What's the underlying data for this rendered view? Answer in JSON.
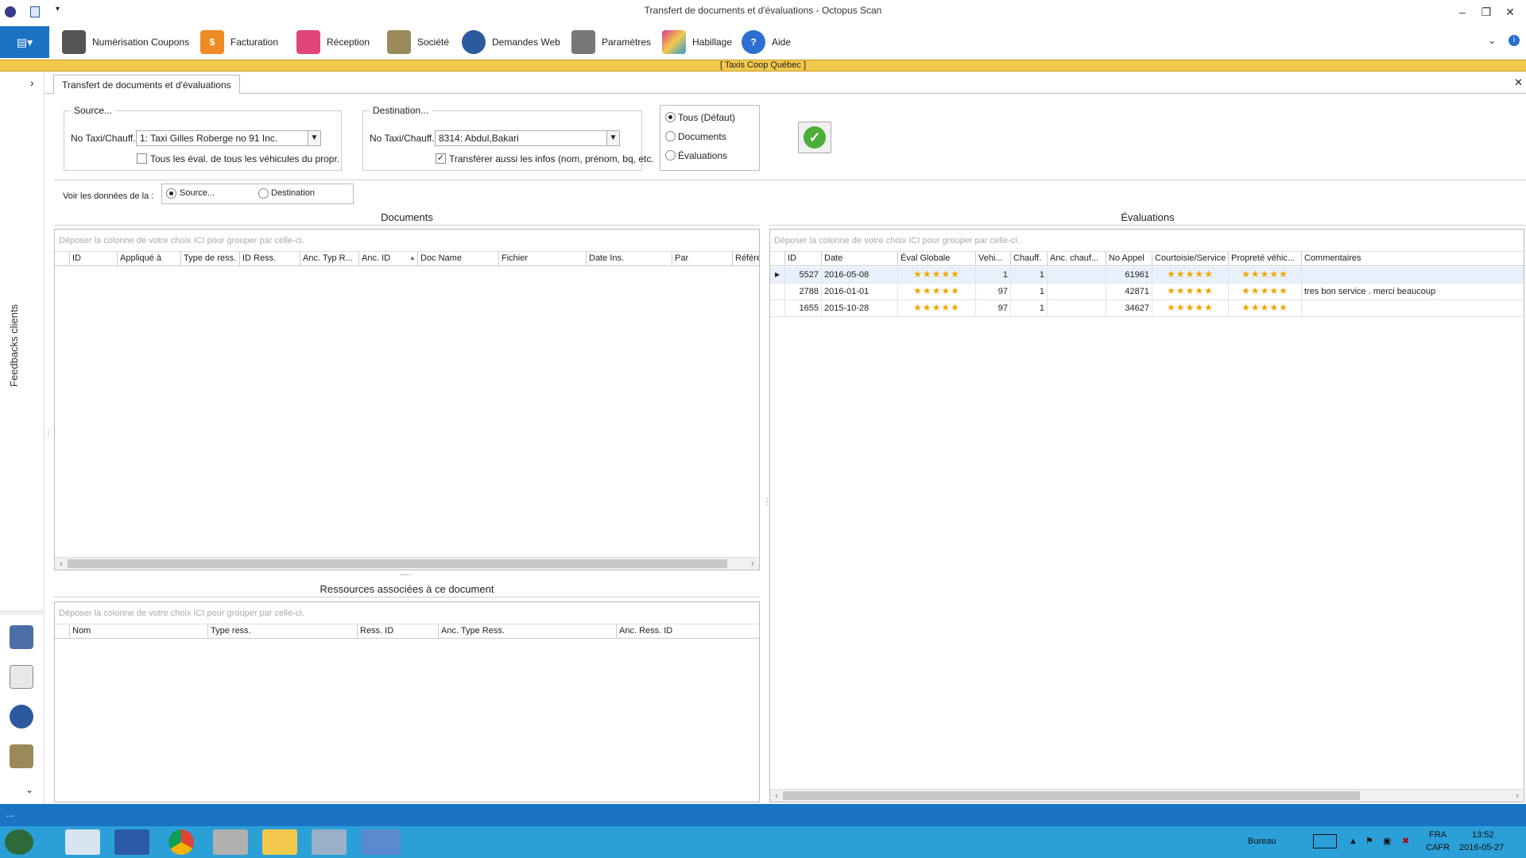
{
  "window": {
    "title": "Transfert de documents et d'évaluations - Octopus Scan"
  },
  "menu": [
    {
      "label": "Numérisation Coupons",
      "icon": "scanner-icon",
      "color": "#555555"
    },
    {
      "label": "Facturation",
      "icon": "billing-icon",
      "color": "#f08a24"
    },
    {
      "label": "Réception",
      "icon": "home-icon",
      "color": "#e0457b"
    },
    {
      "label": "Société",
      "icon": "building-icon",
      "color": "#9a8a5a"
    },
    {
      "label": "Demandes Web",
      "icon": "globe-icon",
      "color": "#2c5aa0"
    },
    {
      "label": "Paramètres",
      "icon": "tools-icon",
      "color": "#777777"
    },
    {
      "label": "Habillage",
      "icon": "palette-icon",
      "color": "#d63c8a"
    },
    {
      "label": "Aide",
      "icon": "help-icon",
      "color": "#2a6fd1"
    }
  ],
  "company": "[   Taxis Coop Québec   ]",
  "sidebar": {
    "label": "Feedbacks clients"
  },
  "tab": {
    "label": "Transfert de documents et d'évaluations"
  },
  "source": {
    "legend": "Source...",
    "field_label": "No Taxi/Chauff.",
    "value": "1: Taxi Gilles Roberge no 91 Inc.",
    "checkbox_label": "Tous les éval. de tous les véhicules du propr.",
    "checkbox_checked": false
  },
  "destination": {
    "legend": "Destination...",
    "field_label": "No Taxi/Chauff.",
    "value": "8314: Abdul,Bakari",
    "checkbox_label": "Transférer aussi les infos (nom, prénom, bq, etc.",
    "checkbox_checked": true
  },
  "filter": {
    "options": [
      "Tous (Défaut)",
      "Documents",
      "Évaluations"
    ],
    "selected": "Tous (Défaut)"
  },
  "view": {
    "label": "Voir les données de la :",
    "options": [
      "Source...",
      "Destination"
    ],
    "selected": "Source..."
  },
  "group_hint": "Déposer la colonne de votre choix ICI pour grouper par celle-ci.",
  "documents": {
    "title": "Documents",
    "columns": [
      "ID",
      "Appliqué à",
      "Type de ress.",
      "ID Ress.",
      "Anc. Typ R...",
      "Anc. ID",
      "Doc Name",
      "Fichier",
      "Date Ins.",
      "Par",
      "Référe"
    ]
  },
  "resources": {
    "title": "Ressources associées à ce document",
    "columns": [
      "Nom",
      "Type ress.",
      "Ress. ID",
      "Anc. Type Ress.",
      "Anc. Ress. ID"
    ]
  },
  "evaluations": {
    "title": "Évaluations",
    "columns": [
      "ID",
      "Date",
      "Éval Globale",
      "Vehi...",
      "Chauff.",
      "Anc. chauf...",
      "No Appel",
      "Courtoisie/Service",
      "Propreté véhic...",
      "Commentaires"
    ],
    "rows": [
      {
        "id": "5527",
        "date": "2016-05-08",
        "global": 5,
        "vehicle": "1",
        "driver": "1",
        "old_driver": "",
        "call": "61961",
        "courtesy": 5,
        "cleanliness": 5,
        "comment": ""
      },
      {
        "id": "2788",
        "date": "2016-01-01",
        "global": 5,
        "vehicle": "97",
        "driver": "1",
        "old_driver": "",
        "call": "42871",
        "courtesy": 5,
        "cleanliness": 5,
        "comment": "tres bon service . merci beaucoup"
      },
      {
        "id": "1655",
        "date": "2015-10-28",
        "global": 5,
        "vehicle": "97",
        "driver": "1",
        "old_driver": "",
        "call": "34627",
        "courtesy": 5,
        "cleanliness": 5,
        "comment": ""
      }
    ]
  },
  "statusbar": {
    "text": "..."
  },
  "taskbar": {
    "desktop_label": "Bureau",
    "lang1": "FRA",
    "lang2": "CAFR",
    "time": "13:52",
    "date": "2016-05-27"
  }
}
